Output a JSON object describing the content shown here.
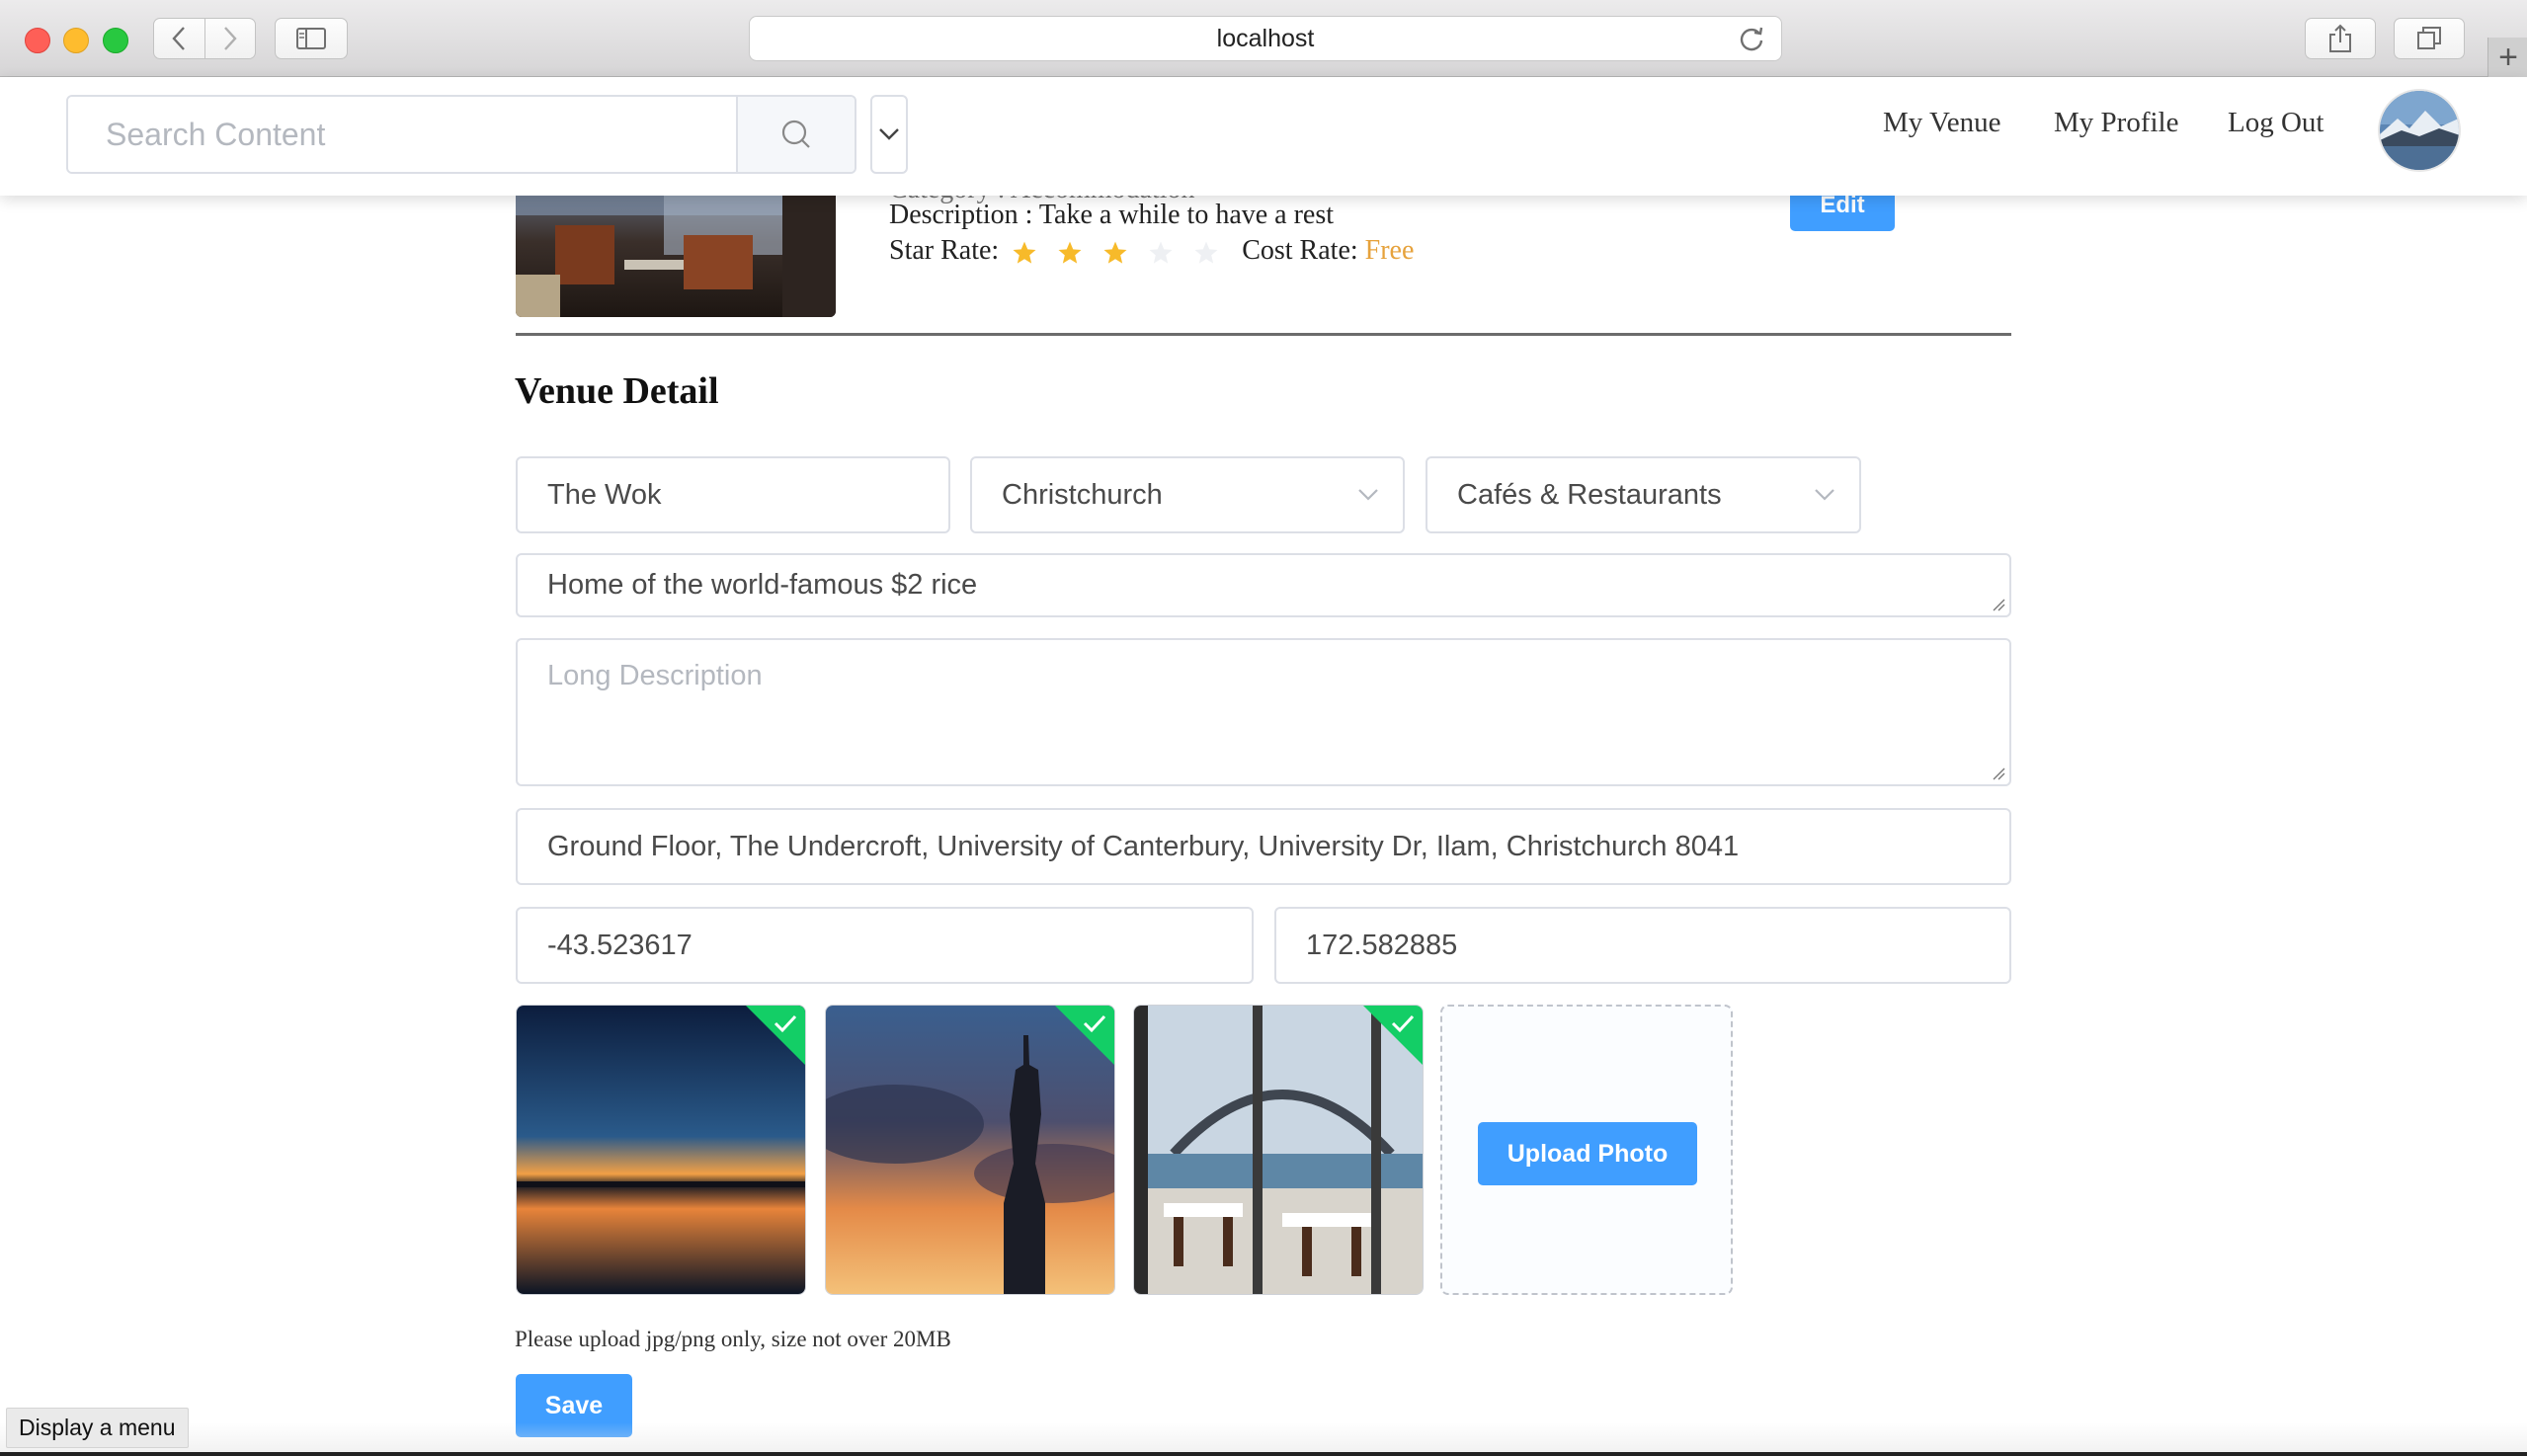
{
  "browser": {
    "url": "localhost",
    "new_tab_symbol": "+"
  },
  "header": {
    "search_placeholder": "Search Content",
    "nav": [
      "My Venue",
      "My Profile",
      "Log Out"
    ]
  },
  "previous_venue": {
    "category_partial": "Category : Accommodation",
    "description": "Description : Take a while to have a rest",
    "star_label": "Star Rate:",
    "star_rating": 3,
    "star_max": 5,
    "cost_label": "Cost Rate:",
    "cost_value": "Free",
    "edit_label": "Edit"
  },
  "form": {
    "title": "Venue Detail",
    "name_value": "The Wok",
    "city_value": "Christchurch",
    "category_value": "Cafés & Restaurants",
    "short_description_value": "Home of the world-famous $2 rice",
    "long_description_placeholder": "Long Description",
    "address_value": "Ground Floor, The Undercroft, University of Canterbury, University Dr, Ilam, Christchurch 8041",
    "latitude_value": "-43.523617",
    "longitude_value": "172.582885",
    "upload_label": "Upload Photo",
    "hint": "Please upload jpg/png only, size not over 20MB",
    "save_label": "Save"
  },
  "tooltip": "Display a menu",
  "colors": {
    "primary": "#409eff",
    "success": "#13ce66",
    "star": "#f7ba2a",
    "cost": "#e6a23c"
  }
}
